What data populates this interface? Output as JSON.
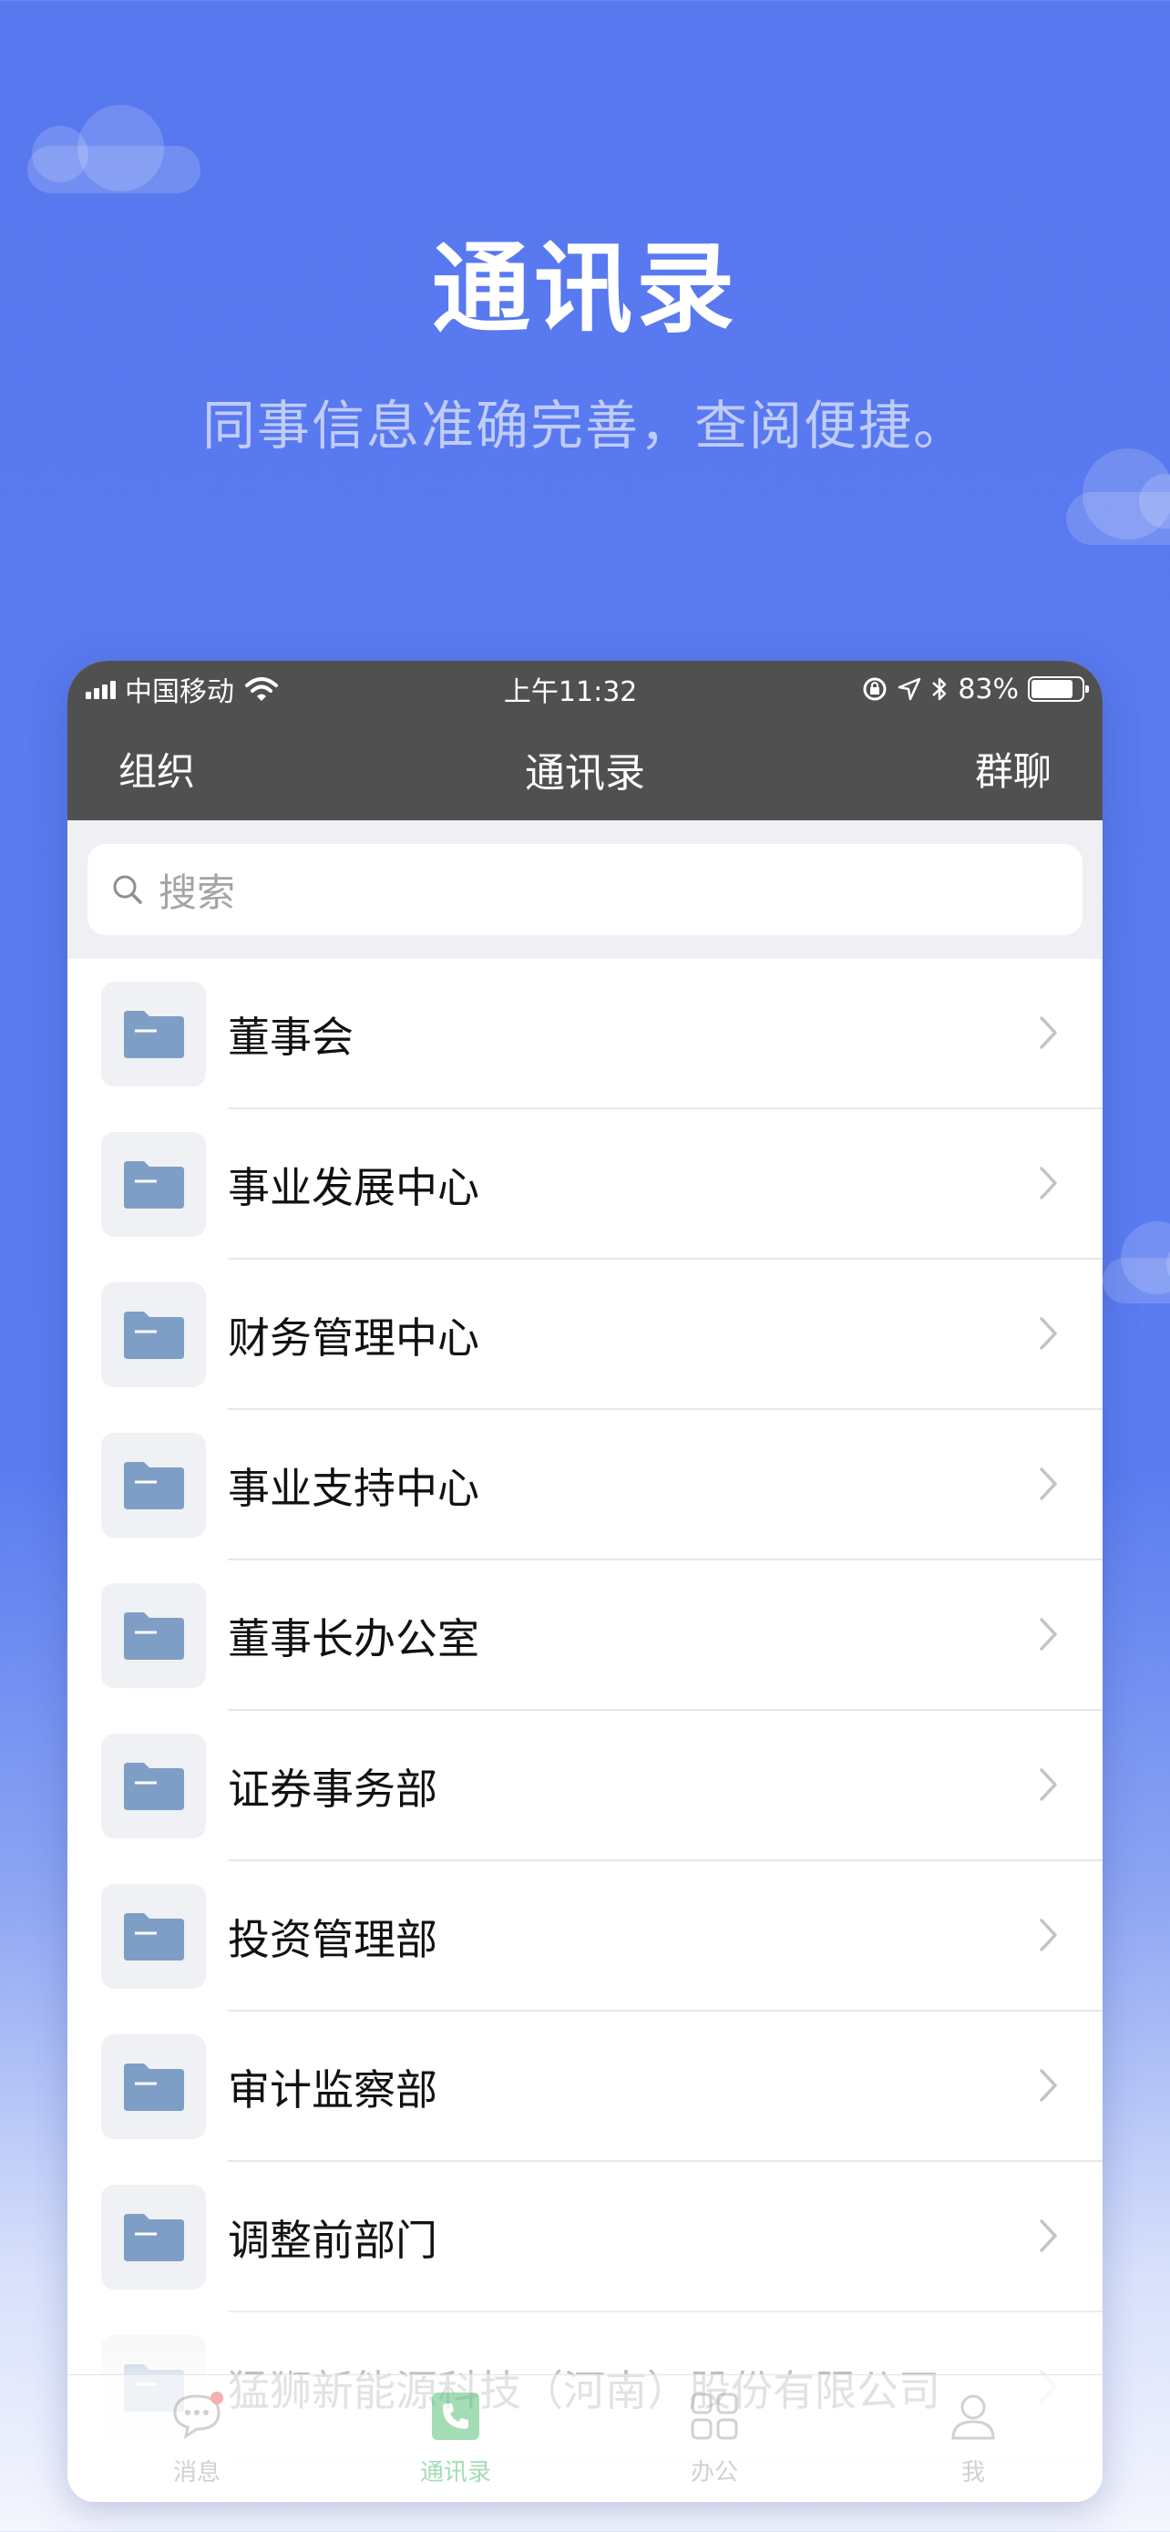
{
  "hero": {
    "title": "通讯录",
    "subtitle": "同事信息准确完善，查阅便捷。"
  },
  "status_bar": {
    "carrier": "中国移动",
    "time": "上午11:32",
    "battery": "83%",
    "battery_level": 0.83
  },
  "nav": {
    "left": "组织",
    "title": "通讯录",
    "right": "群聊"
  },
  "search": {
    "placeholder": "搜索"
  },
  "list": {
    "items": [
      {
        "label": "董事会",
        "icon": "folder-icon"
      },
      {
        "label": "事业发展中心",
        "icon": "folder-icon"
      },
      {
        "label": "财务管理中心",
        "icon": "folder-icon"
      },
      {
        "label": "事业支持中心",
        "icon": "folder-icon"
      },
      {
        "label": "董事长办公室",
        "icon": "folder-icon"
      },
      {
        "label": "证券事务部",
        "icon": "folder-icon"
      },
      {
        "label": "投资管理部",
        "icon": "folder-icon"
      },
      {
        "label": "审计监察部",
        "icon": "folder-icon"
      },
      {
        "label": "调整前部门",
        "icon": "folder-icon"
      },
      {
        "label": "猛狮新能源科技（河南）股份有限公司",
        "icon": "folder-icon"
      }
    ]
  },
  "tabbar": {
    "tabs": [
      {
        "label": "消息",
        "icon": "chat-bubble-icon"
      },
      {
        "label": "通讯录",
        "icon": "contacts-phone-icon"
      },
      {
        "label": "办公",
        "icon": "apps-grid-icon"
      },
      {
        "label": "我",
        "icon": "person-icon"
      }
    ],
    "active_index": 1
  },
  "colors": {
    "brand_blue": "#5878ef",
    "nav_dark": "#505050",
    "folder": "#7f9ec6",
    "active_tab": "#34b45a"
  }
}
